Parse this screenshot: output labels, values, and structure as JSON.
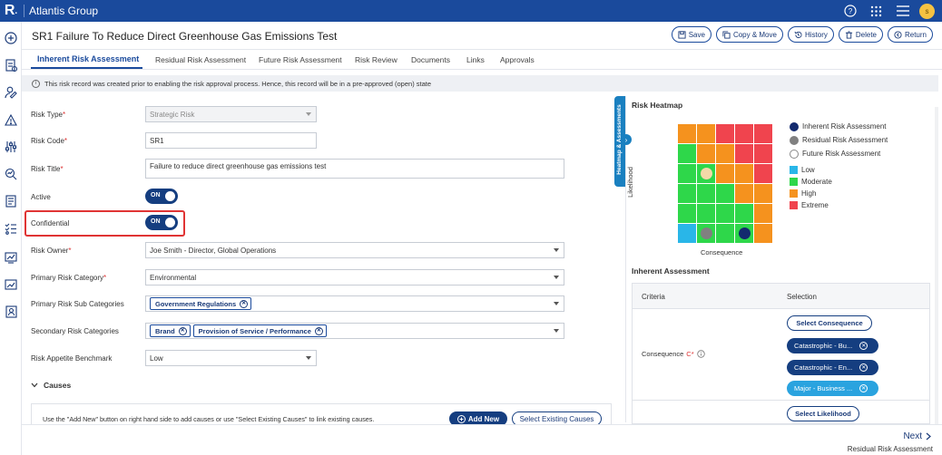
{
  "app": {
    "title": "Atlantis Group",
    "logo_text": "R",
    "avatar_initial": "s"
  },
  "icons": {
    "topbar": [
      "help-icon",
      "apps-grid-icon",
      "menu-icon"
    ],
    "rail": [
      "add-icon",
      "document-list-icon",
      "user-edit-icon",
      "warning-icon",
      "sliders-icon",
      "search-analytics-icon",
      "report-icon",
      "checklist-icon",
      "dashboard-icon",
      "chart-icon",
      "id-card-icon"
    ]
  },
  "header": {
    "title": "SR1 Failure To Reduce Direct Greenhouse Gas Emissions Test",
    "buttons": {
      "save": "Save",
      "copy_move": "Copy & Move",
      "history": "History",
      "delete": "Delete",
      "return": "Return"
    }
  },
  "tabs": [
    {
      "label": "Inherent Risk Assessment",
      "active": true
    },
    {
      "label": "Residual Risk Assessment"
    },
    {
      "label": "Future Risk Assessment"
    },
    {
      "label": "Risk Review"
    },
    {
      "label": "Documents"
    },
    {
      "label": "Links"
    },
    {
      "label": "Approvals"
    }
  ],
  "banner": {
    "text": "This risk record was created prior to enabling the risk approval process. Hence, this record will be in a pre-approved (open) state"
  },
  "form": {
    "risk_type": {
      "label": "Risk Type",
      "value": "Strategic Risk"
    },
    "risk_code": {
      "label": "Risk Code",
      "value": "SR1"
    },
    "risk_title": {
      "label": "Risk Title",
      "value": "Failure to reduce direct greenhouse gas emissions test"
    },
    "active": {
      "label": "Active",
      "state": "ON"
    },
    "confidential": {
      "label": "Confidential",
      "state": "ON"
    },
    "risk_owner": {
      "label": "Risk Owner",
      "value": "Joe Smith - Director, Global Operations"
    },
    "primary_category": {
      "label": "Primary Risk Category",
      "value": "Environmental"
    },
    "primary_sub": {
      "label": "Primary Risk Sub Categories",
      "chips": [
        "Government Regulations"
      ]
    },
    "secondary": {
      "label": "Secondary Risk Categories",
      "chips": [
        "Brand",
        "Provision of Service / Performance"
      ]
    },
    "appetite": {
      "label": "Risk Appetite Benchmark",
      "value": "Low"
    },
    "required_mark": "*"
  },
  "causes": {
    "section_label": "Causes",
    "hint": "Use the \"Add New\" button on right hand side to add causes or use \"Select Existing Causes\" to link existing causes.",
    "add_new": "Add New",
    "select_existing": "Select Existing Causes"
  },
  "side_tab": {
    "label": "Heatmap & Assessments"
  },
  "heatmap": {
    "title": "Risk Heatmap",
    "y_axis": "Likelihood",
    "x_axis": "Consequence",
    "colors": {
      "Low": "#29b6e8",
      "Moderate": "#2ed74a",
      "High": "#f5921e",
      "Extreme": "#f0444e"
    },
    "grid": [
      [
        "High",
        "High",
        "Extreme",
        "Extreme",
        "Extreme"
      ],
      [
        "Moderate",
        "High",
        "High",
        "Extreme",
        "Extreme"
      ],
      [
        "Moderate",
        "Moderate",
        "High",
        "High",
        "Extreme"
      ],
      [
        "Moderate",
        "Moderate",
        "Moderate",
        "High",
        "High"
      ],
      [
        "Moderate",
        "Moderate",
        "Moderate",
        "Moderate",
        "High"
      ],
      [
        "Low",
        "Moderate",
        "Moderate",
        "Moderate",
        "High"
      ]
    ],
    "markers": [
      {
        "series": "Future Risk Assessment",
        "row": 2,
        "col": 1,
        "color": "#f3d9a8"
      },
      {
        "series": "Residual Risk Assessment",
        "row": 5,
        "col": 1,
        "color": "#808080"
      },
      {
        "series": "Inherent Risk Assessment",
        "row": 5,
        "col": 3,
        "color": "#132a6e"
      }
    ],
    "legend_assessments": [
      {
        "label": "Inherent Risk Assessment",
        "color": "#132a6e"
      },
      {
        "label": "Residual Risk Assessment",
        "color": "#808080"
      },
      {
        "label": "Future Risk Assessment",
        "color": "#ffffff"
      }
    ],
    "legend_levels": [
      "Low",
      "Moderate",
      "High",
      "Extreme"
    ]
  },
  "inherent": {
    "title": "Inherent Assessment",
    "col_criteria": "Criteria",
    "col_selection": "Selection",
    "consequence_label": "Consequence",
    "consequence_mark": "C*",
    "select_consequence": "Select Consequence",
    "consequence_chips": [
      {
        "label": "Catastrophic - Bu...",
        "color": "#153e80"
      },
      {
        "label": "Catastrophic - En...",
        "color": "#153e80"
      },
      {
        "label": "Major - Business ...",
        "color": "#2aa3df"
      }
    ],
    "select_likelihood": "Select Likelihood"
  },
  "footer": {
    "next": "Next",
    "next_sub": "Residual Risk Assessment"
  }
}
